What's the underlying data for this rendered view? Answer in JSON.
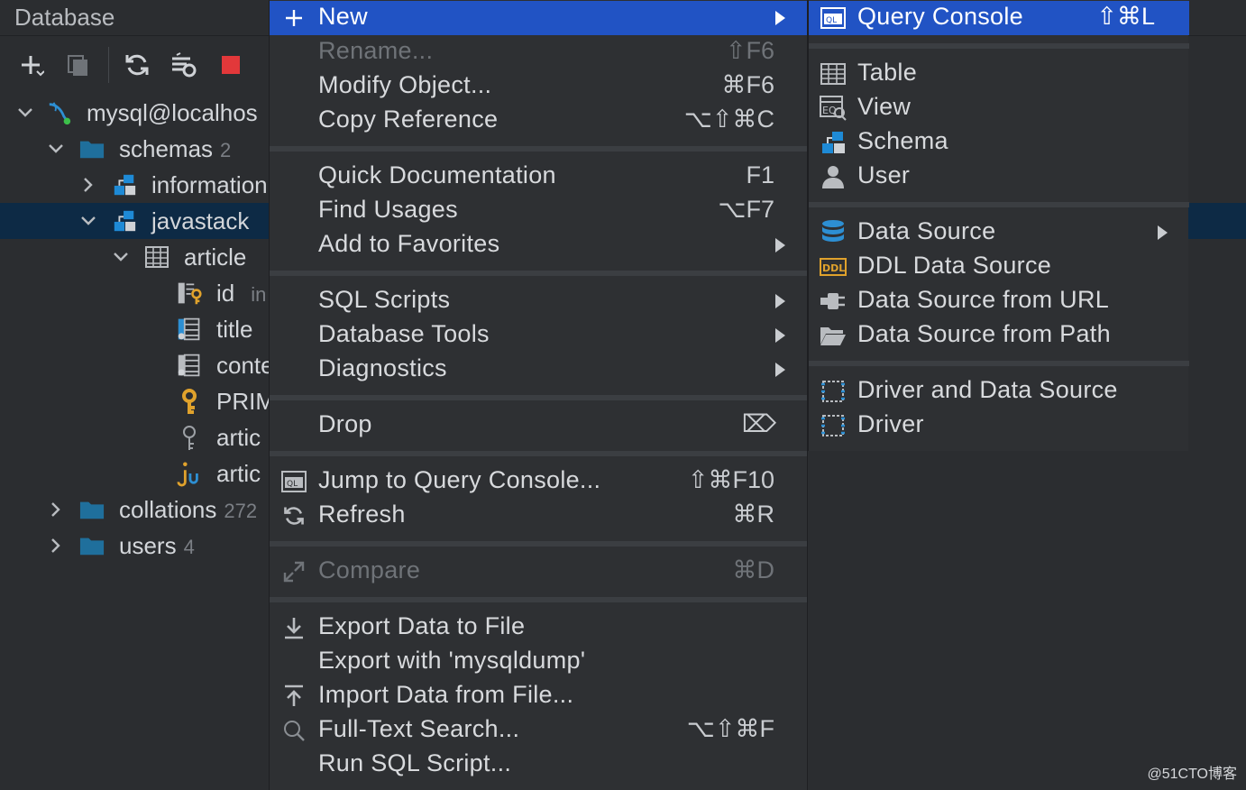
{
  "tool_window": {
    "title": "Database"
  },
  "toolbar": {
    "add": "plus-icon",
    "duplicate": "duplicate-icon",
    "refresh": "refresh-icon",
    "settings": "data-source-properties-icon",
    "stop": "stop-icon"
  },
  "tree": {
    "root": {
      "label": "mysql@localhos"
    },
    "schemas": {
      "label": "schemas",
      "count": "2"
    },
    "information": {
      "label": "information"
    },
    "javastack": {
      "label": "javastack"
    },
    "article": {
      "label": "article"
    },
    "columns": [
      {
        "label": "id",
        "type": "in"
      },
      {
        "label": "title",
        "type": ""
      },
      {
        "label": "conte",
        "type": ""
      }
    ],
    "primary": {
      "label": "PRIM"
    },
    "index1": {
      "label": "artic"
    },
    "index2": {
      "label": "artic"
    },
    "collations": {
      "label": "collations",
      "count": "272"
    },
    "users": {
      "label": "users",
      "count": "4"
    }
  },
  "context_menu": {
    "items": [
      {
        "label": "New",
        "shortcut": "",
        "submenu": true
      },
      {
        "label": "Rename...",
        "shortcut": "⇧F6",
        "disabled": true
      },
      {
        "label": "Modify Object...",
        "shortcut": "⌘F6"
      },
      {
        "label": "Copy Reference",
        "shortcut": "⌥⇧⌘C"
      },
      {
        "label": "Quick Documentation",
        "shortcut": "F1"
      },
      {
        "label": "Find Usages",
        "shortcut": "⌥F7"
      },
      {
        "label": "Add to Favorites",
        "shortcut": "",
        "submenu": true
      },
      {
        "label": "SQL Scripts",
        "shortcut": "",
        "submenu": true
      },
      {
        "label": "Database Tools",
        "shortcut": "",
        "submenu": true
      },
      {
        "label": "Diagnostics",
        "shortcut": "",
        "submenu": true
      },
      {
        "label": "Drop",
        "shortcut": "⌦"
      },
      {
        "label": "Jump to Query Console...",
        "shortcut": "⇧⌘F10"
      },
      {
        "label": "Refresh",
        "shortcut": "⌘R"
      },
      {
        "label": "Compare",
        "shortcut": "⌘D",
        "disabled": true
      },
      {
        "label": "Export Data to File",
        "shortcut": ""
      },
      {
        "label": "Export with 'mysqldump'",
        "shortcut": ""
      },
      {
        "label": "Import Data from File...",
        "shortcut": ""
      },
      {
        "label": "Full-Text Search...",
        "shortcut": "⌥⇧⌘F"
      },
      {
        "label": "Run SQL Script...",
        "shortcut": ""
      }
    ]
  },
  "submenu": {
    "items": [
      {
        "label": "Query Console",
        "shortcut": "⇧⌘L"
      },
      {
        "label": "Table"
      },
      {
        "label": "View"
      },
      {
        "label": "Schema"
      },
      {
        "label": "User"
      },
      {
        "label": "Data Source",
        "submenu": true
      },
      {
        "label": "DDL Data Source"
      },
      {
        "label": "Data Source from URL"
      },
      {
        "label": "Data Source from Path"
      },
      {
        "label": "Driver and Data Source"
      },
      {
        "label": "Driver"
      }
    ]
  },
  "watermark": "@51CTO博客",
  "colors": {
    "highlight": "#2153c4",
    "selection": "#0d2a45",
    "schema_blue": "#1e8ad6",
    "folder_blue": "#1f6f9c",
    "key_gold": "#e0a22c"
  }
}
